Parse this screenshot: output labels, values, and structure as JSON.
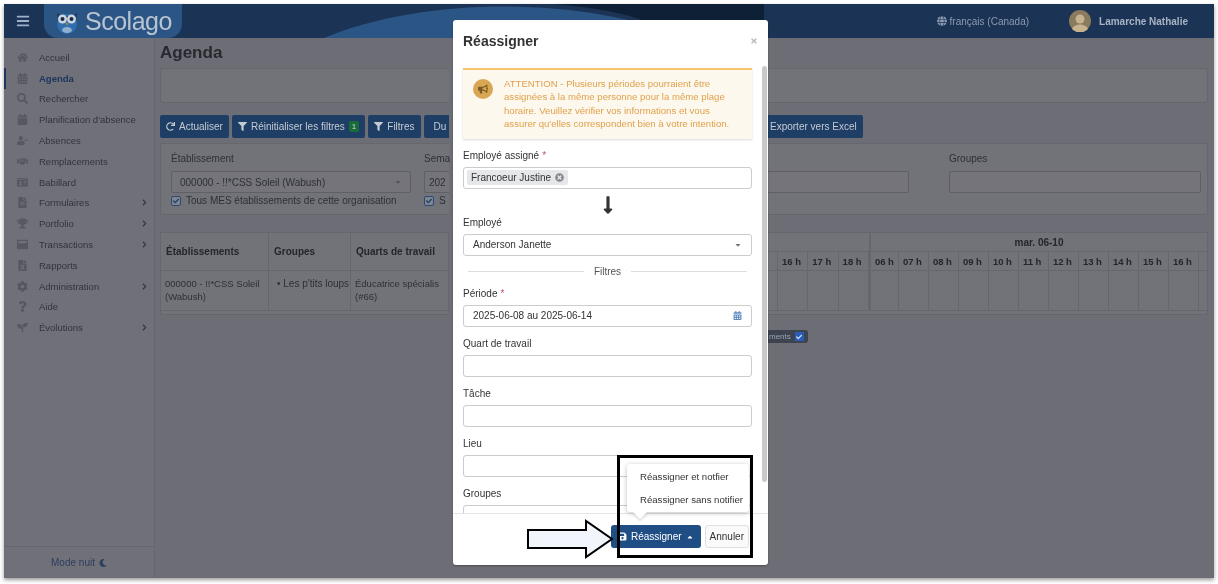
{
  "header": {
    "brand": "Scolago",
    "language": "français (Canada)",
    "user": "Lamarche Nathalie"
  },
  "sidebar": {
    "items": [
      {
        "label": "Accueil",
        "selected": false,
        "expandable": false
      },
      {
        "label": "Agenda",
        "selected": true,
        "expandable": false
      },
      {
        "label": "Rechercher",
        "selected": false,
        "expandable": false
      },
      {
        "label": "Planification d'absence",
        "selected": false,
        "expandable": false
      },
      {
        "label": "Absences",
        "selected": false,
        "expandable": false
      },
      {
        "label": "Remplacements",
        "selected": false,
        "expandable": false
      },
      {
        "label": "Babillard",
        "selected": false,
        "expandable": false
      },
      {
        "label": "Formulaires",
        "selected": false,
        "expandable": true
      },
      {
        "label": "Portfolio",
        "selected": false,
        "expandable": true
      },
      {
        "label": "Transactions",
        "selected": false,
        "expandable": true
      },
      {
        "label": "Rapports",
        "selected": false,
        "expandable": false
      },
      {
        "label": "Administration",
        "selected": false,
        "expandable": true
      },
      {
        "label": "Aide",
        "selected": false,
        "expandable": false
      },
      {
        "label": "Évolutions",
        "selected": false,
        "expandable": true
      }
    ],
    "night_mode": "Mode nuit"
  },
  "page": {
    "title": "Agenda",
    "toolbar": [
      {
        "label": "Actualiser"
      },
      {
        "label": "Réinitialiser les filtres",
        "badge": "1"
      },
      {
        "label": "Filtres"
      },
      {
        "label": "Du"
      }
    ],
    "export_button": "Exporter vers Excel",
    "filters": {
      "establishment": {
        "label": "Établissement",
        "value": "000000 - !!*CSS Soleil (Wabush)",
        "checkbox": {
          "label": "Tous MES établissements de cette organisation",
          "checked": true
        }
      },
      "column_2": {
        "label": "Sema",
        "value": "202",
        "checkbox": {
          "label": "S",
          "checked": true
        }
      },
      "groups": {
        "label": "Groupes"
      }
    },
    "table": {
      "columns": [
        "Établissements",
        "Groupes",
        "Quarts de travail"
      ],
      "rows": [
        {
          "establishment": "000000 - !!*CSS Soleil (Wabush)",
          "groups": [
            "• Les p'tits loups"
          ],
          "shift": "Éducatrice spécialis\n(#66)"
        }
      ],
      "hours_before": [
        "16 h",
        "17 h",
        "18 h"
      ],
      "day": "mar. 06-10",
      "hours": [
        "06 h",
        "07 h",
        "08 h",
        "09 h",
        "10 h",
        "11 h",
        "12 h",
        "13 h",
        "14 h",
        "15 h",
        "16 h"
      ]
    },
    "legend_badge": {
      "label": "ments",
      "checked": true
    }
  },
  "modal": {
    "title": "Réassigner",
    "alert": "ATTENTION - Plusieurs périodes pourraient être assignées à la même personne pour la même plage horaire. Veuillez vérifier vos informations et vous assurer qu'elles correspondent bien à votre intention.",
    "assigned": {
      "label": "Employé assigné",
      "required_mark": "*",
      "tags": [
        "Francoeur Justine"
      ]
    },
    "employee": {
      "label": "Employé",
      "value": "Anderson Janette"
    },
    "filters_heading": "Filtres",
    "fields": [
      {
        "kind": "date",
        "label": "Période",
        "required_mark": "*",
        "value": "2025-06-08 au 2025-06-14"
      },
      {
        "kind": "text",
        "label": "Quart de travail"
      },
      {
        "kind": "text",
        "label": "Tâche"
      },
      {
        "kind": "text",
        "label": "Lieu"
      },
      {
        "kind": "text",
        "label": "Groupes"
      }
    ],
    "menu": [
      "Réassigner et notfier",
      "Réassigner sans notifier"
    ],
    "primary_button": "Réassigner",
    "cancel_button": "Annuler"
  }
}
